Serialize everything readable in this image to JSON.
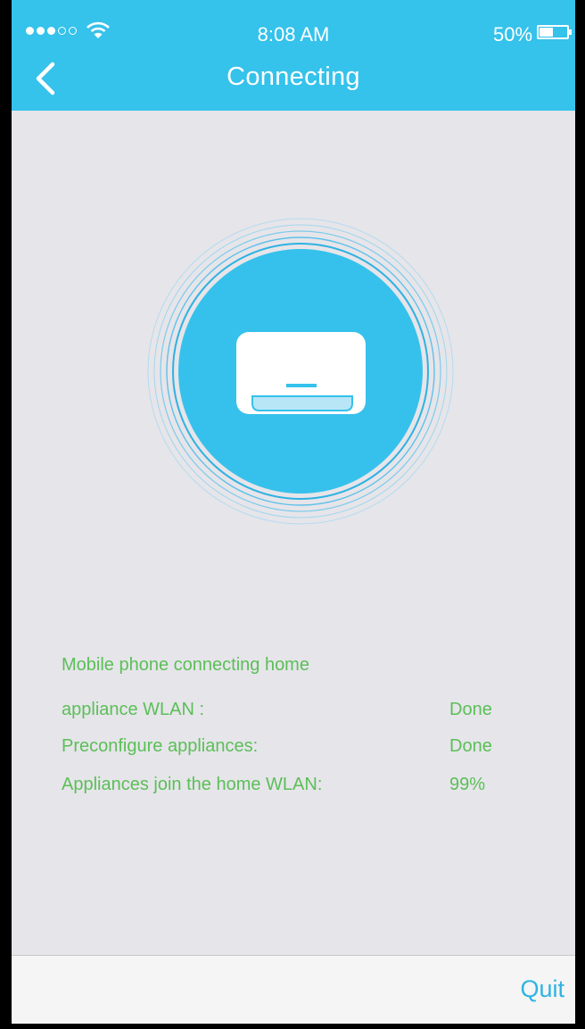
{
  "status_bar": {
    "signal_dots": "●●●○○",
    "time": "8:08 AM",
    "battery_percent": "50%",
    "battery_level": 0.5
  },
  "nav": {
    "back_icon": "chevron-left-icon",
    "title": "Connecting"
  },
  "device": {
    "icon": "air-conditioner-icon"
  },
  "progress": {
    "steps": [
      {
        "label": "Mobile phone connecting home",
        "value": ""
      },
      {
        "label": "appliance WLAN :",
        "value": "Done"
      },
      {
        "label": "Preconfigure appliances:",
        "value": "Done"
      },
      {
        "label": "Appliances join the home WLAN:",
        "value": "99%"
      }
    ]
  },
  "footer": {
    "quit_label": "Quit"
  },
  "colors": {
    "accent": "#35c2eb",
    "progress_text": "#5bbf57",
    "quit_text": "#2fb3e3",
    "background": "#e6e5ea"
  }
}
